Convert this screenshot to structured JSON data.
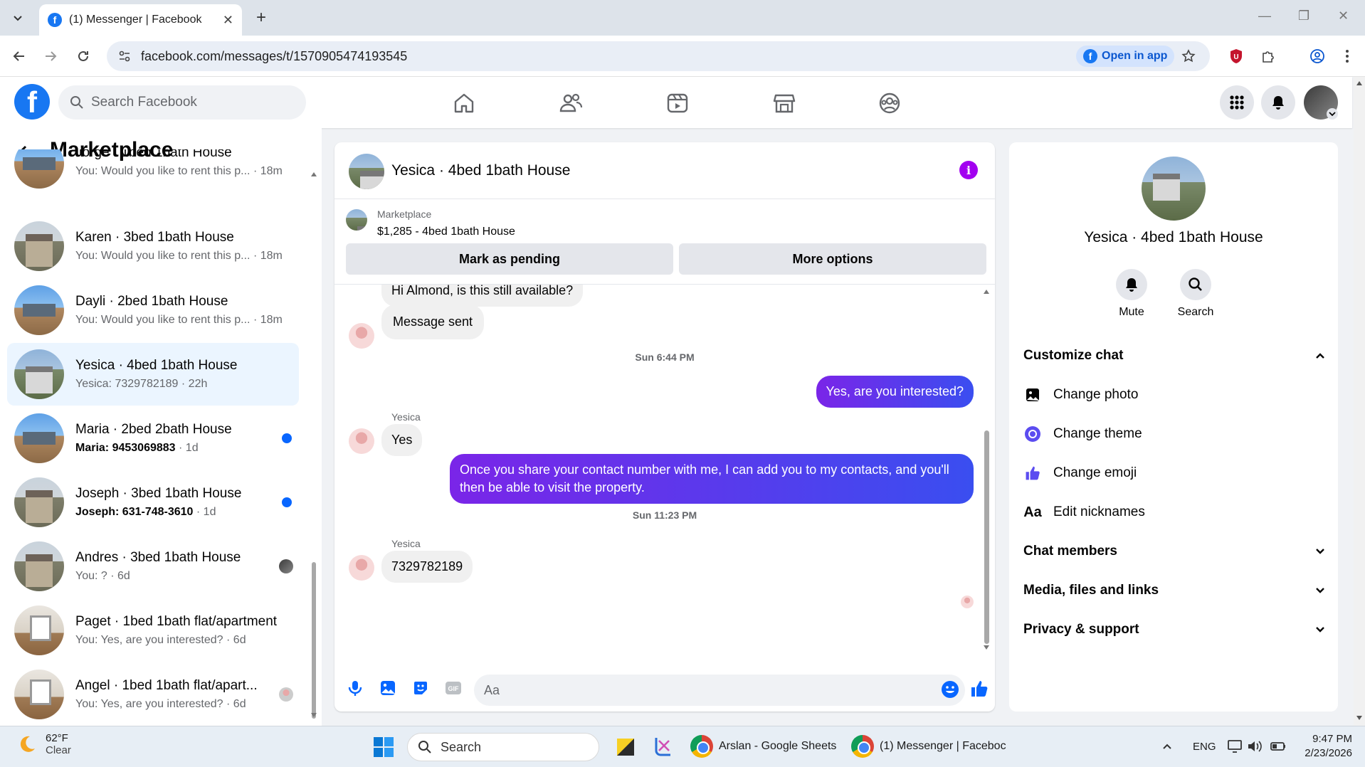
{
  "browser": {
    "tab_title": "(1) Messenger | Facebook",
    "url": "facebook.com/messages/t/1570905474193545",
    "open_in_app": "Open in app"
  },
  "fb_header": {
    "search_placeholder": "Search Facebook"
  },
  "left": {
    "title": "Marketplace",
    "conversations": [
      {
        "name": "Jorge · 1bed 1bath House",
        "preview": "You: Would you like to rent this p...",
        "time": "· 18m",
        "unread": false
      },
      {
        "name": "Karen · 3bed 1bath House",
        "preview": "You: Would you like to rent this p...",
        "time": "· 18m",
        "unread": false
      },
      {
        "name": "Dayli · 2bed 1bath House",
        "preview": "You: Would you like to rent this p...",
        "time": "· 18m",
        "unread": false
      },
      {
        "name": "Yesica · 4bed 1bath House",
        "preview": "Yesica: 7329782189",
        "time": "· 22h",
        "unread": false
      },
      {
        "name": "Maria · 2bed 2bath House",
        "preview": "Maria: 9453069883",
        "time": "· 1d",
        "unread": true
      },
      {
        "name": "Joseph · 3bed 1bath House",
        "preview": "Joseph: 631-748-3610",
        "time": "· 1d",
        "unread": true
      },
      {
        "name": "Andres · 3bed 1bath House",
        "preview": "You: ?",
        "time": "· 6d",
        "unread": false
      },
      {
        "name": "Paget · 1bed 1bath flat/apartment",
        "preview": "You: Yes, are you interested?",
        "time": "· 6d",
        "unread": false
      },
      {
        "name": "Angel · 1bed 1bath flat/apart...",
        "preview": "You: Yes, are you interested?",
        "time": "· 6d",
        "unread": false
      }
    ]
  },
  "chat": {
    "title": "Yesica · 4bed 1bath House",
    "marketplace_label": "Marketplace",
    "listing": "$1,285 - 4bed 1bath House",
    "mark_pending": "Mark as pending",
    "more_options": "More options",
    "messages": {
      "m1": "Hi Almond, is this still available?",
      "m2": "Message sent",
      "ts1": "Sun 6:44 PM",
      "m3": "Yes, are you interested?",
      "sender1": "Yesica",
      "m4": "Yes",
      "m5": "Once you share your contact number with me, I can add you to my contacts, and you'll then be able to visit the property.",
      "ts2": "Sun 11:23 PM",
      "sender2": "Yesica",
      "m6": "7329782189"
    },
    "composer_placeholder": "Aa"
  },
  "right": {
    "name": "Yesica · 4bed 1bath House",
    "mute": "Mute",
    "search": "Search",
    "customize": "Customize chat",
    "change_photo": "Change photo",
    "change_theme": "Change theme",
    "change_emoji": "Change emoji",
    "edit_nicknames": "Edit nicknames",
    "chat_members": "Chat members",
    "media": "Media, files and links",
    "privacy": "Privacy & support"
  },
  "taskbar": {
    "temp": "62°F",
    "cond": "Clear",
    "search": "Search",
    "app1": "Arslan - Google Sheets",
    "app2": "(1) Messenger | Faceboc",
    "lang": "ENG",
    "time": "9:47 PM",
    "date": "2/23/2026"
  },
  "colors": {
    "fb_blue": "#1877f2",
    "messenger_purple": "#7a25e8",
    "info_purple": "#a200f0",
    "unread_dot": "#0866ff"
  }
}
